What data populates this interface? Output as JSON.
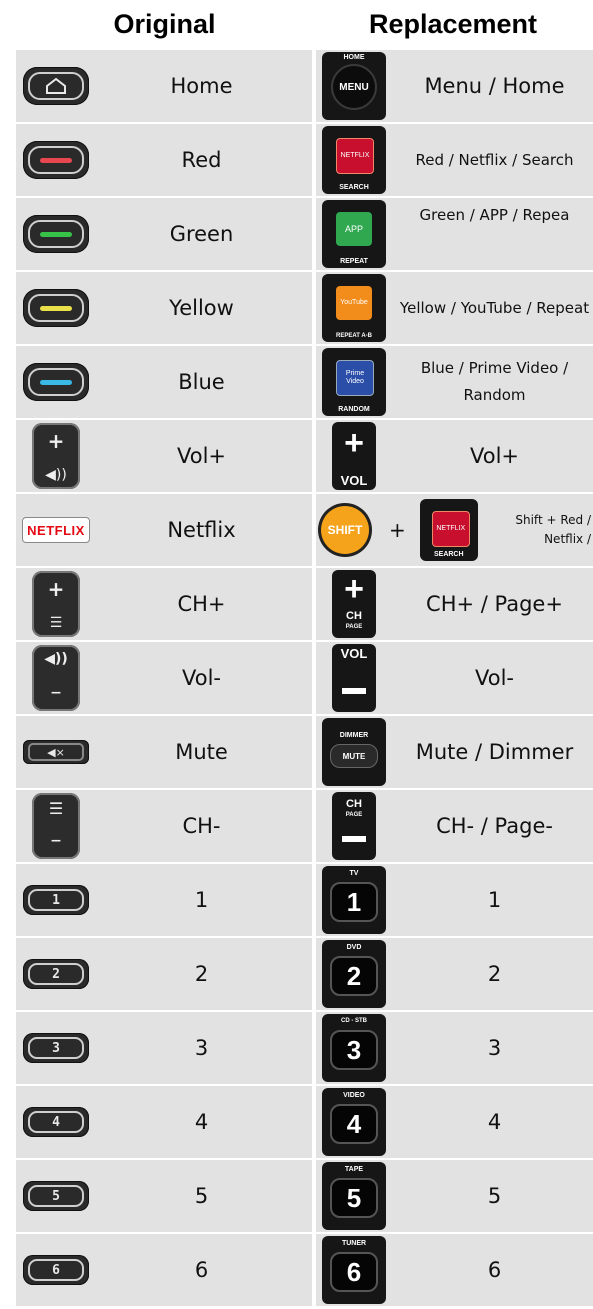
{
  "headers": {
    "original": "Original",
    "replacement": "Replacement"
  },
  "colors": {
    "red": "#e8474f",
    "green": "#37c24a",
    "yellow": "#e9e04a",
    "blue": "#3ab9e6",
    "netflix_red": "#c8102e",
    "app_green": "#2fa84f",
    "youtube_orange": "#f28c1a",
    "prime_blue": "#2b4fa8",
    "shift_orange": "#f5a31a"
  },
  "rows": [
    {
      "original": "Home",
      "replacement": "Menu / Home",
      "orig_icon": "home-icon",
      "repl_caps": {
        "top": "HOME",
        "center": "MENU"
      }
    },
    {
      "original": "Red",
      "replacement": "Red / Netflix / Search",
      "repl_caps": {
        "center": "NETFLIX",
        "bottom": "SEARCH"
      }
    },
    {
      "original": "Green",
      "replacement": "Green / APP / Repea",
      "repl_caps": {
        "center": "APP",
        "bottom": "REPEAT"
      }
    },
    {
      "original": "Yellow",
      "replacement": "Yellow / YouTube / Repeat",
      "repl_caps": {
        "center": "YouTube",
        "bottom": "REPEAT A-B"
      }
    },
    {
      "original": "Blue",
      "replacement": "Blue / Prime Video / Random",
      "repl_caps": {
        "center": "Prime Video",
        "bottom": "RANDOM"
      }
    },
    {
      "original": "Vol+",
      "replacement": "Vol+",
      "orig_icon": "volume-up-icon",
      "repl_caps": {
        "bottom": "VOL"
      }
    },
    {
      "original": "Netflix",
      "replacement": "Shift + Red / Netflix /",
      "orig_badge": "NETFLIX",
      "repl_caps": {
        "shift": "SHIFT",
        "plus": "+",
        "center": "NETFLIX",
        "bottom": "SEARCH"
      }
    },
    {
      "original": "CH+",
      "replacement": "CH+ / Page+",
      "orig_icon": "channel-up-icon",
      "repl_caps": {
        "center": "CH",
        "bottom": "PAGE"
      }
    },
    {
      "original": "Vol-",
      "replacement": "Vol-",
      "orig_icon": "volume-down-icon",
      "repl_caps": {
        "top": "VOL"
      }
    },
    {
      "original": "Mute",
      "replacement": "Mute / Dimmer",
      "orig_icon": "mute-icon",
      "repl_caps": {
        "top": "DIMMER",
        "center": "MUTE"
      }
    },
    {
      "original": "CH-",
      "replacement": "CH- / Page-",
      "orig_icon": "channel-down-icon",
      "repl_caps": {
        "center": "CH",
        "bottom": "PAGE"
      }
    },
    {
      "original": "1",
      "replacement": "1",
      "orig_digit": "1",
      "repl_caps": {
        "top": "TV",
        "center": "1"
      }
    },
    {
      "original": "2",
      "replacement": "2",
      "orig_digit": "2",
      "repl_caps": {
        "top": "DVD",
        "center": "2"
      }
    },
    {
      "original": "3",
      "replacement": "3",
      "orig_digit": "3",
      "repl_caps": {
        "top": "CD - STB",
        "center": "3"
      }
    },
    {
      "original": "4",
      "replacement": "4",
      "orig_digit": "4",
      "repl_caps": {
        "top": "VIDEO",
        "center": "4"
      }
    },
    {
      "original": "5",
      "replacement": "5",
      "orig_digit": "5",
      "repl_caps": {
        "top": "TAPE",
        "center": "5"
      }
    },
    {
      "original": "6",
      "replacement": "6",
      "orig_digit": "6",
      "repl_caps": {
        "top": "TUNER",
        "center": "6"
      }
    }
  ]
}
